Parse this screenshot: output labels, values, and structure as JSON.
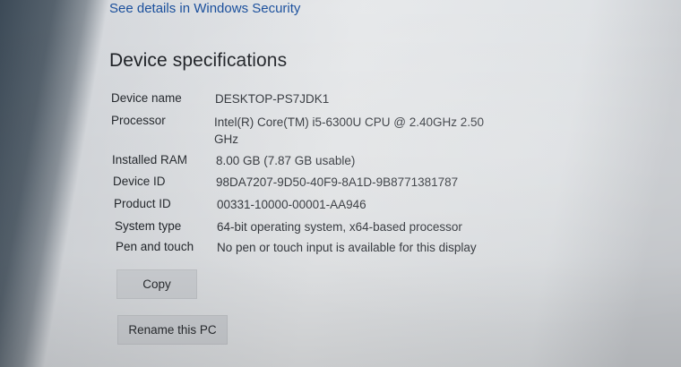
{
  "security_link": "See details in Windows Security",
  "section_title": "Device specifications",
  "specs": [
    {
      "label": "Device name",
      "value": "DESKTOP-PS7JDK1"
    },
    {
      "label": "Processor",
      "value": "Intel(R) Core(TM) i5-6300U CPU @ 2.40GHz   2.50 GHz"
    },
    {
      "label": "Installed RAM",
      "value": "8.00 GB (7.87 GB usable)"
    },
    {
      "label": "Device ID",
      "value": "98DA7207-9D50-40F9-8A1D-9B8771381787"
    },
    {
      "label": "Product ID",
      "value": "00331-10000-00001-AA946"
    },
    {
      "label": "System type",
      "value": "64-bit operating system, x64-based processor"
    },
    {
      "label": "Pen and touch",
      "value": "No pen or touch input is available for this display"
    }
  ],
  "buttons": {
    "copy": "Copy",
    "rename": "Rename this PC"
  },
  "colors": {
    "link": "#1a4f9c",
    "button_bg": "#cfd2d6"
  }
}
